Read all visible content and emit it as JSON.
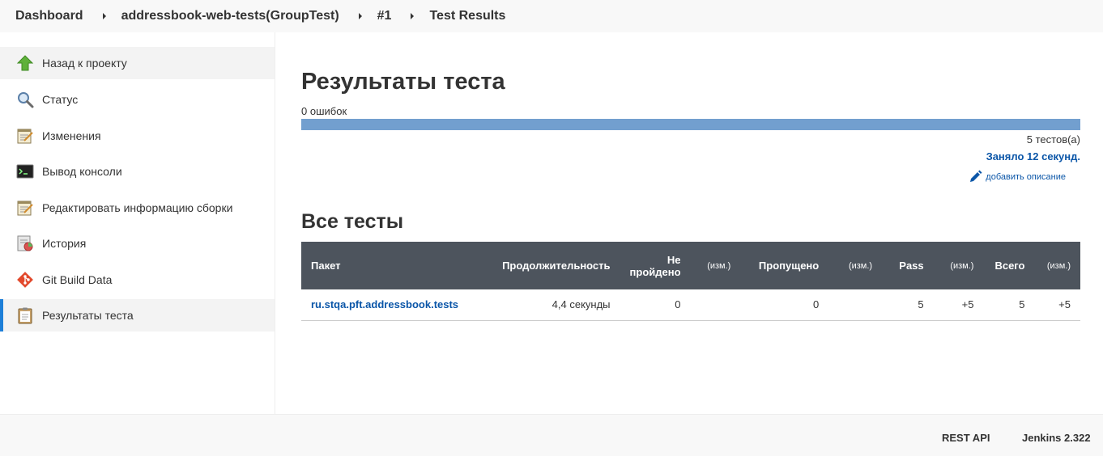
{
  "breadcrumb": {
    "items": [
      "Dashboard",
      "addressbook-web-tests(GroupTest)",
      "#1",
      "Test Results"
    ]
  },
  "sidebar": {
    "items": [
      {
        "label": "Назад к проекту",
        "icon": "up-arrow-icon"
      },
      {
        "label": "Статус",
        "icon": "search-icon"
      },
      {
        "label": "Изменения",
        "icon": "notepad-icon"
      },
      {
        "label": "Вывод консоли",
        "icon": "terminal-icon"
      },
      {
        "label": "Редактировать информацию сборки",
        "icon": "notepad-icon"
      },
      {
        "label": "История",
        "icon": "history-icon"
      },
      {
        "label": "Git Build Data",
        "icon": "git-icon"
      },
      {
        "label": "Результаты теста",
        "icon": "clipboard-icon"
      }
    ],
    "active_index": 7
  },
  "main": {
    "title": "Результаты теста",
    "failures": "0 ошибок",
    "progress_fraction": 1.0,
    "tests_count": "5 тестов(а)",
    "took": "Заняло 12 секунд.",
    "add_description": "добавить описание",
    "all_tests_heading": "Все тесты"
  },
  "table": {
    "headers": {
      "package": "Пакет",
      "duration": "Продолжительность",
      "failed": "Не пройдено",
      "diff1": "(изм.)",
      "skipped": "Пропущено",
      "diff2": "(изм.)",
      "pass": "Pass",
      "diff3": "(изм.)",
      "total": "Всего",
      "diff4": "(изм.)"
    },
    "rows": [
      {
        "package": "ru.stqa.pft.addressbook.tests",
        "duration": "4,4 секунды",
        "failed": "0",
        "failed_diff": "",
        "skipped": "0",
        "skipped_diff": "",
        "pass": "5",
        "pass_diff": "+5",
        "total": "5",
        "total_diff": "+5"
      }
    ]
  },
  "footer": {
    "rest_api": "REST API",
    "version": "Jenkins 2.322"
  },
  "colors": {
    "progress": "#729fcf",
    "link": "#0b56a8",
    "table_header": "#4d545d",
    "active_marker": "#1e7fd8"
  }
}
